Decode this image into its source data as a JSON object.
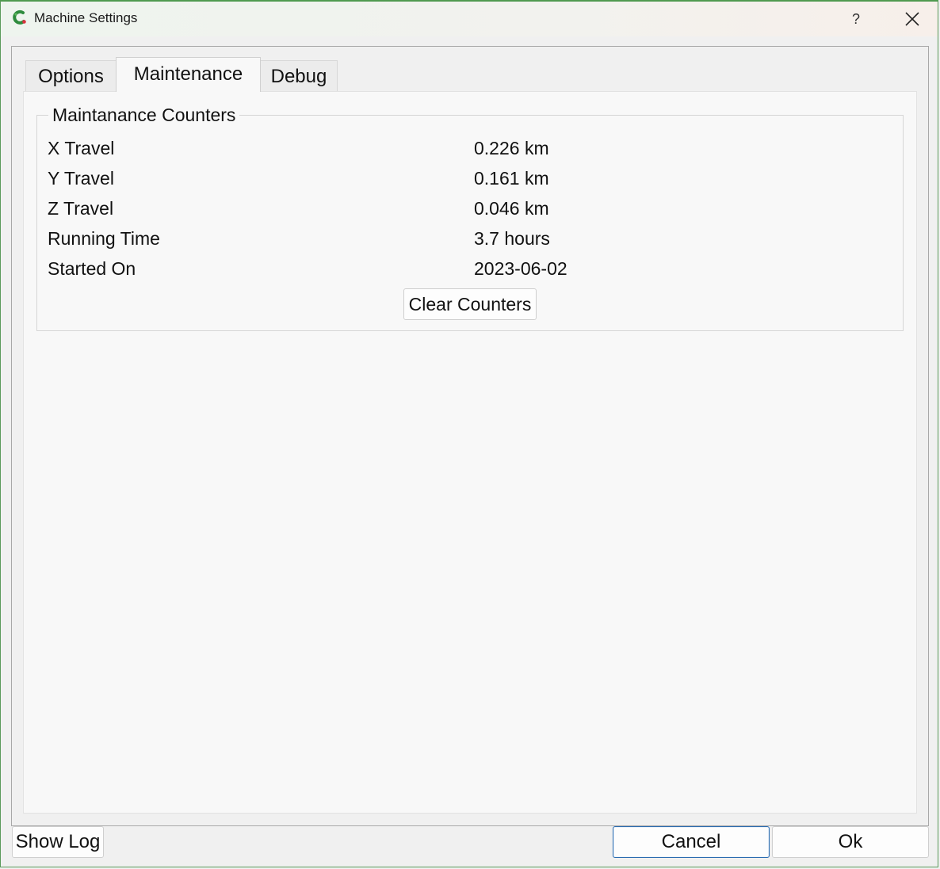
{
  "window": {
    "title": "Machine Settings",
    "help_label": "?",
    "icons": {
      "app": "app-logo-icon",
      "close": "close-icon"
    }
  },
  "tabs": [
    {
      "label": "Options",
      "selected": false
    },
    {
      "label": "Maintenance",
      "selected": true
    },
    {
      "label": "Debug",
      "selected": false
    }
  ],
  "maintenance": {
    "group_title": "Maintanance Counters",
    "rows": [
      {
        "label": "X Travel",
        "value": "0.226 km"
      },
      {
        "label": "Y Travel",
        "value": "0.161 km"
      },
      {
        "label": "Z Travel",
        "value": "0.046 km"
      },
      {
        "label": "Running Time",
        "value": "3.7 hours"
      },
      {
        "label": "Started On",
        "value": "2023-06-02"
      }
    ],
    "clear_button": "Clear Counters"
  },
  "footer": {
    "show_log": "Show Log",
    "cancel": "Cancel",
    "ok": "Ok"
  }
}
